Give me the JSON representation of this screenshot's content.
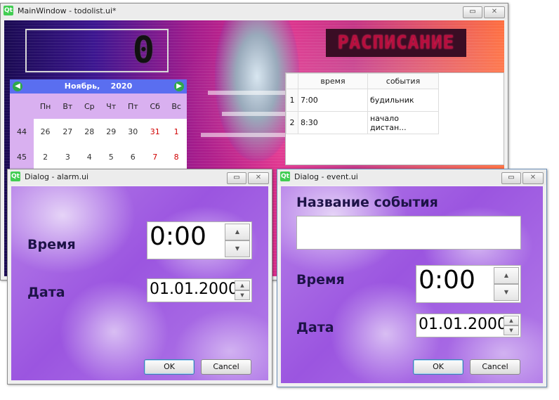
{
  "main_window": {
    "title": "MainWindow - todolist.ui*",
    "lcd_value": "0",
    "banner": "РАСПИСАНИЕ",
    "calendar": {
      "month_label": "Ноябрь,",
      "year_label": "2020",
      "weekdays": [
        "Пн",
        "Вт",
        "Ср",
        "Чт",
        "Пт",
        "Сб",
        "Вс"
      ],
      "rows": [
        {
          "week": "44",
          "days": [
            "26",
            "27",
            "28",
            "29",
            "30",
            "31",
            "1"
          ]
        },
        {
          "week": "45",
          "days": [
            "2",
            "3",
            "4",
            "5",
            "6",
            "7",
            "8"
          ]
        }
      ]
    },
    "schedule": {
      "headers": [
        "время",
        "события"
      ],
      "rows": [
        {
          "num": "1",
          "time": "7:00",
          "event": "будильник"
        },
        {
          "num": "2",
          "time": "8:30",
          "event": "начало дистан..."
        }
      ]
    }
  },
  "alarm_dialog": {
    "title": "Dialog - alarm.ui",
    "time_label": "Время",
    "time_value": "0:00",
    "date_label": "Дата",
    "date_value": "01.01.2000",
    "ok": "OK",
    "cancel": "Cancel"
  },
  "event_dialog": {
    "title": "Dialog - event.ui",
    "name_label": "Название события",
    "name_value": "",
    "time_label": "Время",
    "time_value": "0:00",
    "date_label": "Дата",
    "date_value": "01.01.2000",
    "ok": "OK",
    "cancel": "Cancel"
  },
  "icons": {
    "qt_glyph": "Qt",
    "minimize": "▭",
    "close": "✕",
    "up": "▲",
    "down": "▼",
    "prev": "◀",
    "next": "▶"
  }
}
